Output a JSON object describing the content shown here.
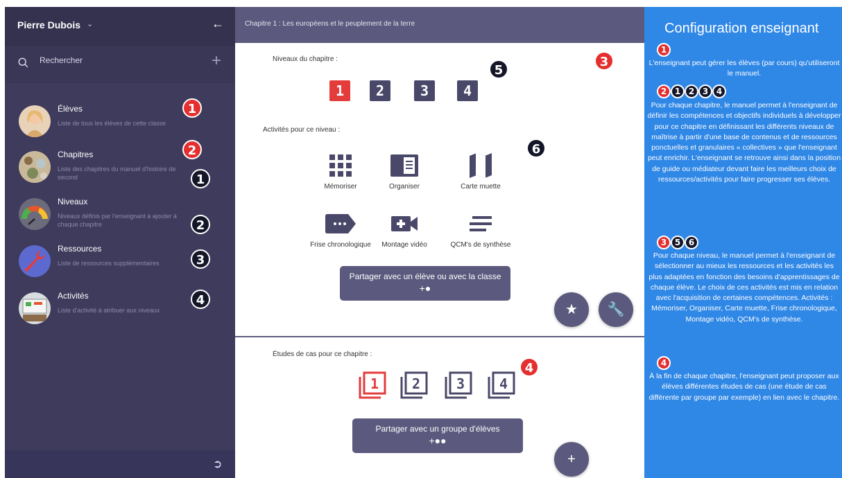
{
  "sidebar": {
    "user_name": "Pierre Dubois",
    "search_placeholder": "Rechercher",
    "items": [
      {
        "title": "Élèves",
        "desc": "Liste de tous les élèves de cette classe"
      },
      {
        "title": "Chapitres",
        "desc": "Liste des chapitres du manuel d'histoire de second"
      },
      {
        "title": "Niveaux",
        "desc": "Niveaux définis par l'enseignant à ajouter à chaque chapitre"
      },
      {
        "title": "Ressources",
        "desc": "Liste de ressources supplémentaires"
      },
      {
        "title": "Activités",
        "desc": "Liste d'activité à atribuer aux niveaux"
      }
    ],
    "badges": [
      "1",
      "2",
      "1",
      "2",
      "3",
      "4"
    ]
  },
  "main": {
    "header": "Chapitre 1 : Les européens et le peuplement de la terre",
    "levels_label": "Niveaux du chapitre :",
    "levels": [
      "1",
      "2",
      "3",
      "4"
    ],
    "activities_label": "Activités pour ce niveau :",
    "activities": [
      "Mémoriser",
      "Organiser",
      "Carte muette",
      "Frise chronologique",
      "Montage vidéo",
      "QCM's de synthèse"
    ],
    "share_class": "Partager avec un élève ou avec la classe",
    "cases_label": "Études de cas pour ce chapitre :",
    "cases": [
      "1",
      "2",
      "3",
      "4"
    ],
    "share_group": "Partager avec un groupe d'élèves",
    "badges": {
      "b3": "3",
      "b5": "5",
      "b6": "6",
      "b4": "4"
    }
  },
  "panel": {
    "title": "Configuration enseignant",
    "s1_badges": [
      "1"
    ],
    "s1_text": "L'enseignant peut gérer les élèves (par cours) qu'utiliseront le manuel.",
    "s2_badges": [
      "2",
      "1",
      "2",
      "3",
      "4"
    ],
    "s2_text": "Pour chaque chapitre, le manuel permet à l'enseignant de définir les compétences et objectifs individuels à développer pour ce chapitre en définissant les différents niveaux de maîtrise à partir d'une base de contenus et de ressources ponctuelles et granulaires « collectives » que l'enseignant peut enrichir. L'enseignant se retrouve ainsi dans la position de guide ou médiateur devant faire les meilleurs choix de ressources/activités pour faire progresser ses élèves.",
    "s3_badges": [
      "3",
      "5",
      "6"
    ],
    "s3_text": "Pour chaque niveau, le manuel permet à l'enseignant de sélectionner au mieux les ressources et les activités les plus adaptées en fonction des besoins d'apprentissages de chaque élève. Le choix de ces activités est mis en relation avec l'acquisition de certaines compétences. Activités : Mémoriser, Organiser, Carte muette, Frise chronologique, Montage vidéo, QCM's de synthèse.",
    "s4_badges": [
      "4"
    ],
    "s4_text": "À la fin de chaque chapitre, l'enseignant peut proposer aux élèves différentes études de cas (une étude de cas différente par groupe par exemple) en lien avec le chapitre."
  },
  "colors": {
    "sidebar": "#3e3b5c",
    "accent": "#5b5a7e",
    "red": "#e43b3b",
    "panel": "#2f87e6"
  }
}
